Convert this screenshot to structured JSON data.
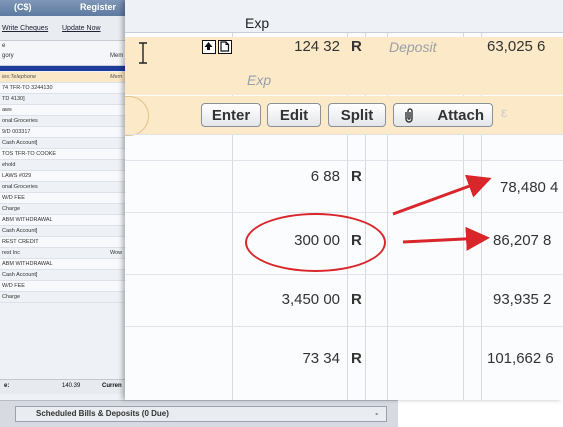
{
  "bg_window": {
    "title_left": "(C$)",
    "title_right": "Register",
    "menu": [
      "Write Cheques",
      "Update Now"
    ],
    "header": {
      "col1": "e",
      "col2": "gory",
      "col3": "Mem"
    },
    "rows": [
      {
        "text": "ies:Telephone",
        "extra": "Mem"
      },
      {
        "text": "74 TFR-TO 3244130"
      },
      {
        "text": "TD 4130]"
      },
      {
        "text": "aws"
      },
      {
        "text": "onal:Groceries"
      },
      {
        "text": "9/D   003317"
      },
      {
        "text": "Cash Account]"
      },
      {
        "text": "TOS TFR-TO COOKE"
      },
      {
        "text": "ehold"
      },
      {
        "text": "LAWS #029"
      },
      {
        "text": "onal:Groceries"
      },
      {
        "text": "W/D FEE"
      },
      {
        "text": "Charge"
      },
      {
        "text": "ABM WITHDRAWAL"
      },
      {
        "text": "Cash Account]"
      },
      {
        "text": "REST CREDIT"
      },
      {
        "text": "rest Inc",
        "extra": "Wow"
      },
      {
        "text": "ABM WITHDRAWAL"
      },
      {
        "text": "Cash Account]"
      },
      {
        "text": "W/D FEE"
      },
      {
        "text": "Charge"
      }
    ],
    "bottom_label": "e:",
    "bottom_value": "140.39",
    "bottom_right": "Curren"
  },
  "scheduled_tab": {
    "label": "Scheduled Bills & Deposits (0 Due)",
    "close": "-"
  },
  "register": {
    "header_col": "Exp",
    "active": {
      "amount": "124 32",
      "cleared": "R",
      "type": "Deposit",
      "balance": "63,025 6",
      "category_placeholder": "Exp"
    },
    "buttons": {
      "enter": "Enter",
      "edit": "Edit",
      "split": "Split",
      "attach": "Attach",
      "extra": "ε"
    },
    "rows": [
      {
        "amount": "6 88",
        "cleared": "R",
        "balance": "78,480 4"
      },
      {
        "amount": "300 00",
        "cleared": "R",
        "balance": "86,207 8"
      },
      {
        "amount": "3,450 00",
        "cleared": "R",
        "balance": "93,935 2"
      },
      {
        "amount": "73 34",
        "cleared": "R",
        "balance": "101,662 6"
      }
    ]
  },
  "icons": {
    "cursor": "ibeam-cursor-icon",
    "upload": "upload-icon",
    "document": "document-icon",
    "paperclip": "paperclip-icon"
  },
  "colors": {
    "annotation": "#d8262a",
    "edit_row": "#fbe9c8"
  }
}
